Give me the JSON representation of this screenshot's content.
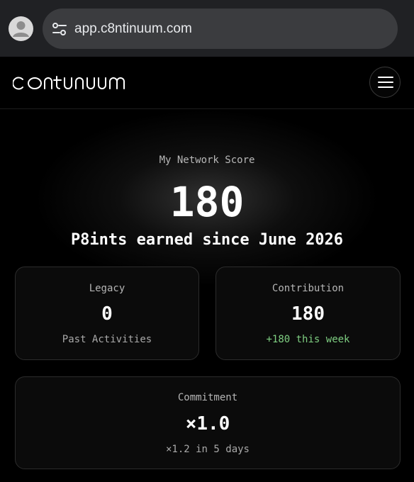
{
  "browser": {
    "url": "app.c8ntinuum.com"
  },
  "app": {
    "logo_text": "continuum"
  },
  "score": {
    "label": "My Network Score",
    "value": "180",
    "caption": "P8ints earned since June 2026"
  },
  "cards": {
    "legacy": {
      "title": "Legacy",
      "value": "0",
      "sub": "Past Activities"
    },
    "contribution": {
      "title": "Contribution",
      "value": "180",
      "sub": "+180 this week"
    },
    "commitment": {
      "title": "Commitment",
      "value": "×1.0",
      "sub": "×1.2 in 5 days"
    }
  },
  "colors": {
    "background": "#000000",
    "browser_bar": "#202124",
    "url_pill": "#3b3c3f",
    "card_background": "#0b0b0b",
    "card_border": "#2c2c2c",
    "positive_text": "#7fcf82"
  }
}
